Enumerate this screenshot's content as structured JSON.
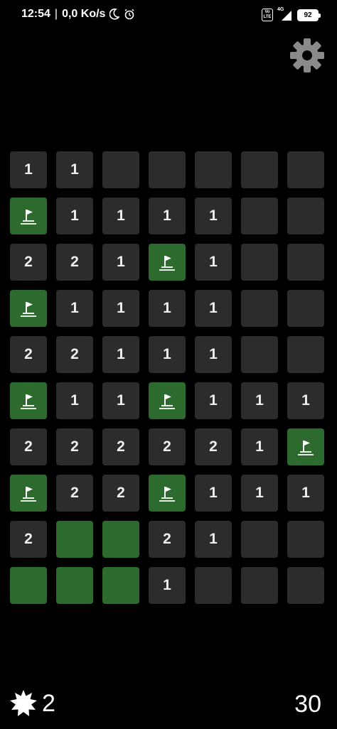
{
  "status_bar": {
    "time": "12:54",
    "separator": "|",
    "network_speed": "0,0 Ko/s",
    "volte_label": "Vo LTE",
    "network_type": "4G",
    "battery_level": "92",
    "icons": [
      "moon-icon",
      "alarm-icon",
      "volte-icon",
      "signal-icon",
      "battery-icon"
    ]
  },
  "settings": {
    "icon": "gear-icon"
  },
  "colors": {
    "background": "#000000",
    "cell": "#2c2c2c",
    "flag_cell": "#2d6a2e",
    "text": "#f0f0f0"
  },
  "board": {
    "columns": 7,
    "rows_count": 10,
    "legend": "n = number, f = flagged, g = green empty, e = unrevealed empty",
    "rows": [
      [
        "1",
        "1",
        "e",
        "e",
        "e",
        "e",
        "e"
      ],
      [
        "f",
        "1",
        "1",
        "1",
        "1",
        "e",
        "e"
      ],
      [
        "2",
        "2",
        "1",
        "f",
        "1",
        "e",
        "e"
      ],
      [
        "f",
        "1",
        "1",
        "1",
        "1",
        "e",
        "e"
      ],
      [
        "2",
        "2",
        "1",
        "1",
        "1",
        "e",
        "e"
      ],
      [
        "f",
        "1",
        "1",
        "f",
        "1",
        "1",
        "1"
      ],
      [
        "2",
        "2",
        "2",
        "2",
        "2",
        "1",
        "f"
      ],
      [
        "f",
        "2",
        "2",
        "f",
        "1",
        "1",
        "1"
      ],
      [
        "2",
        "g",
        "g",
        "2",
        "1",
        "e",
        "e"
      ],
      [
        "g",
        "g",
        "g",
        "1",
        "e",
        "e",
        "e"
      ]
    ]
  },
  "footer": {
    "mines_icon": "mine-icon",
    "mines_remaining": "2",
    "timer": "30"
  }
}
